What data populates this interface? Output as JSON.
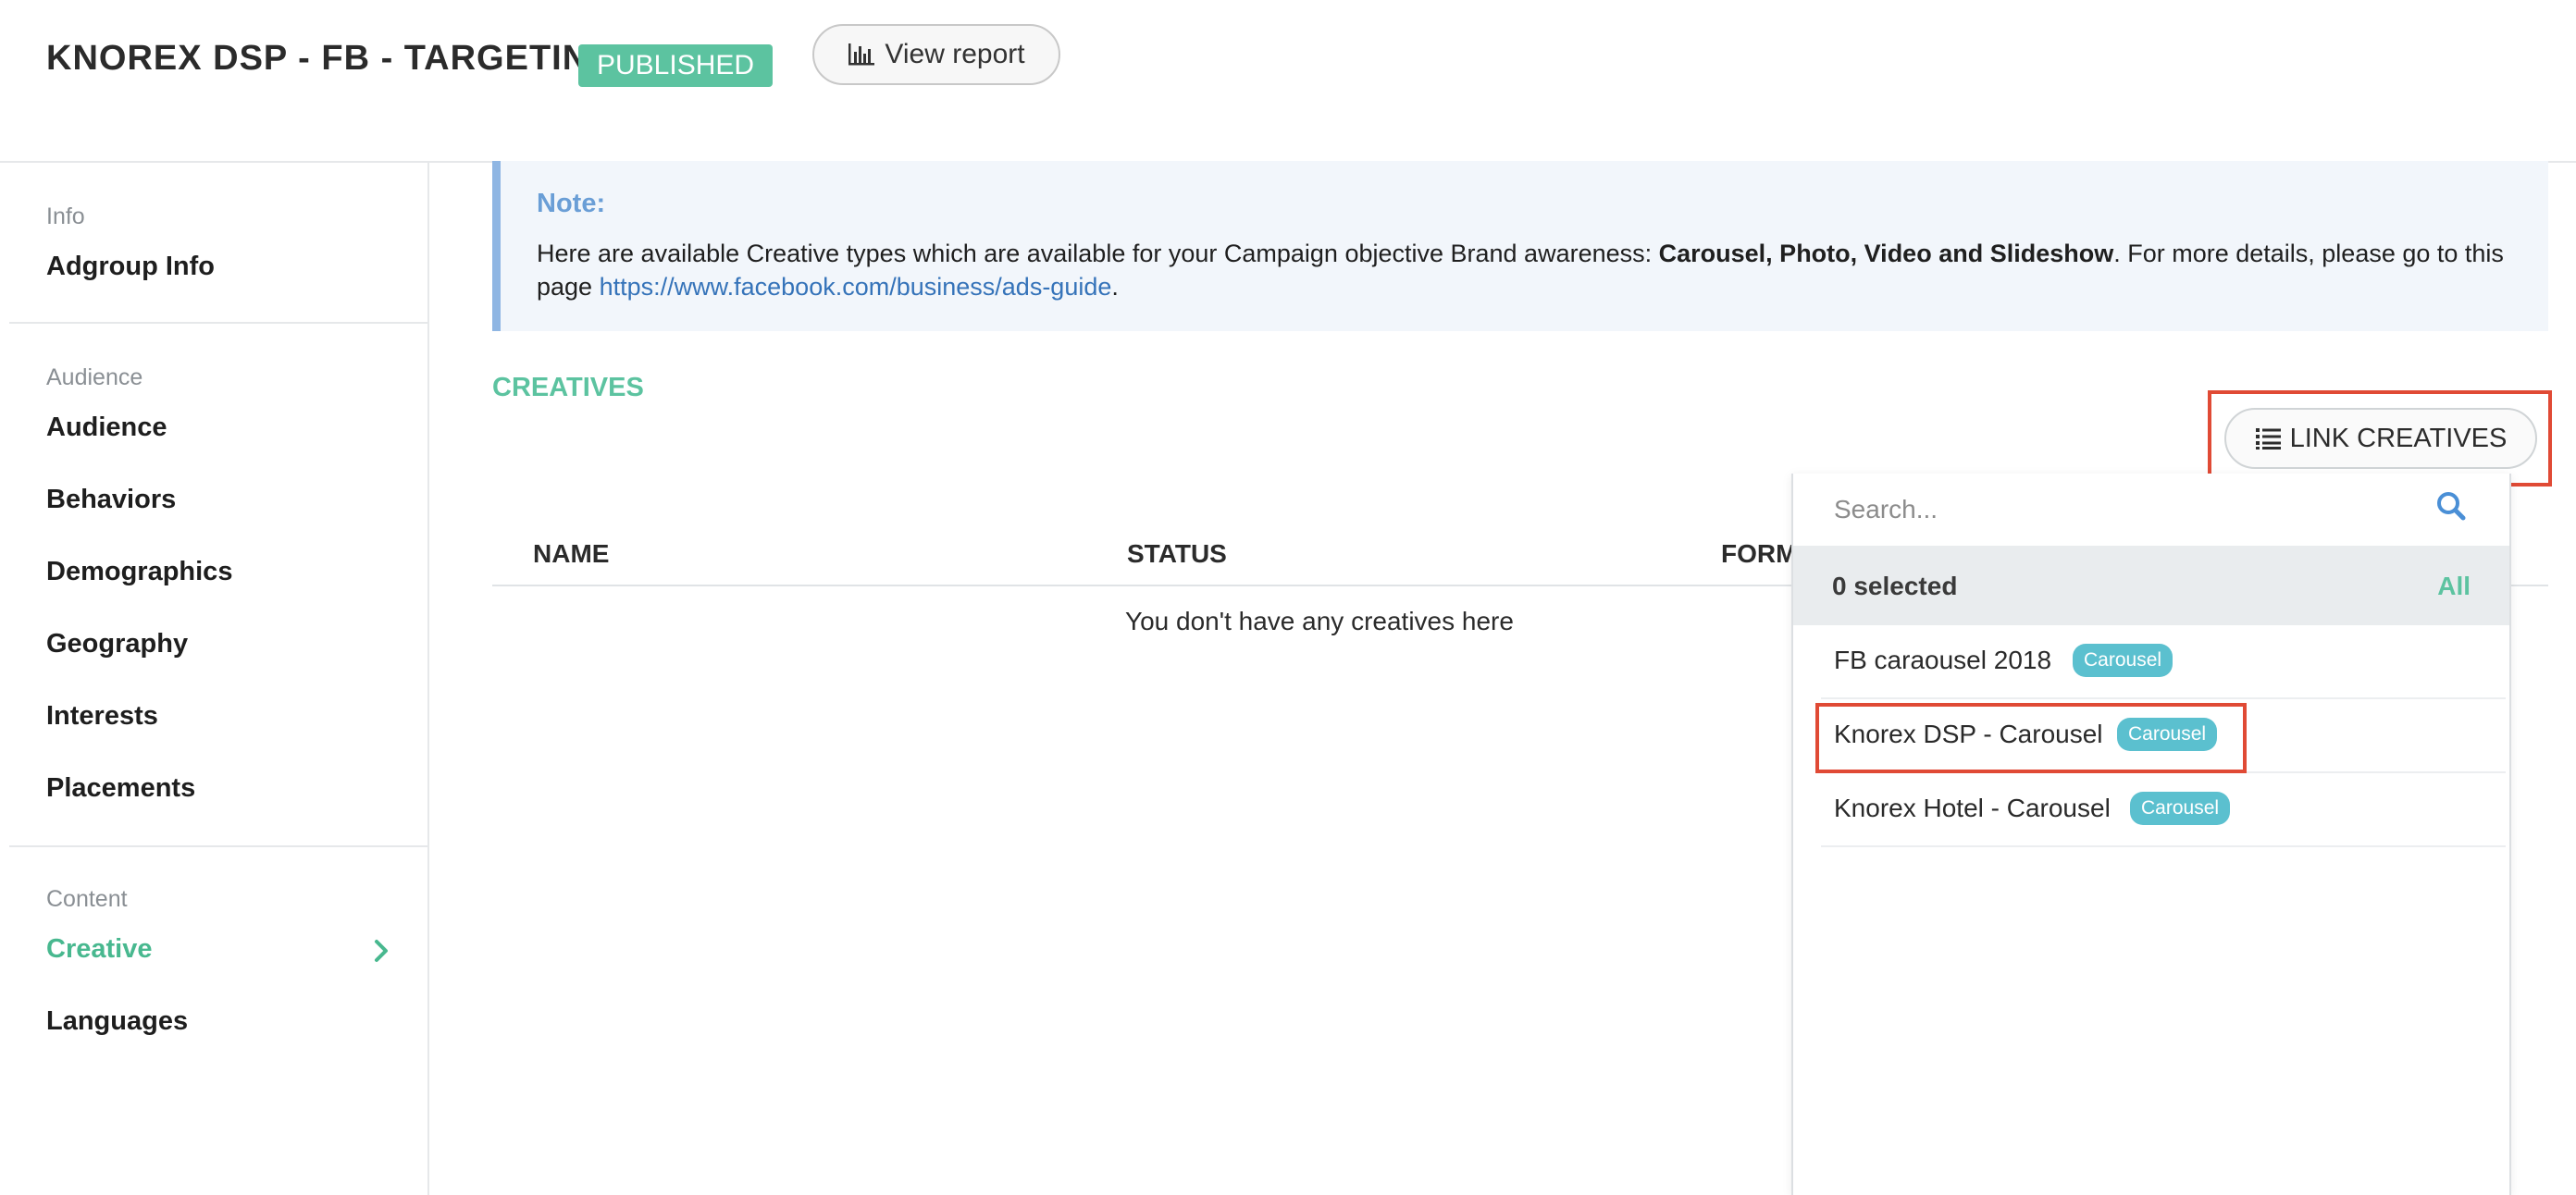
{
  "header": {
    "title": "KNOREX DSP - FB - TARGETING",
    "status_badge": "PUBLISHED",
    "view_report_label": "View report"
  },
  "sidebar": {
    "sections": [
      {
        "label": "Info",
        "items": [
          "Adgroup Info"
        ]
      },
      {
        "label": "Audience",
        "items": [
          "Audience",
          "Behaviors",
          "Demographics",
          "Geography",
          "Interests",
          "Placements"
        ]
      },
      {
        "label": "Content",
        "items": [
          "Creative",
          "Languages"
        ]
      }
    ],
    "active_item": "Creative"
  },
  "note": {
    "title": "Note:",
    "text_before": "Here are available Creative types which are available for your Campaign objective Brand awareness: ",
    "types_bold": "Carousel, Photo, Video and Slideshow",
    "text_after": ". For more details, please go to this page ",
    "link": "https://www.facebook.com/business/ads-guide",
    "text_end": "."
  },
  "creatives": {
    "heading": "CREATIVES",
    "link_button_label": "LINK CREATIVES",
    "columns": [
      "NAME",
      "STATUS",
      "FORM"
    ],
    "empty_message": "You don't have any creatives here"
  },
  "dropdown": {
    "search_placeholder": "Search...",
    "selected_text": "0 selected",
    "all_label": "All",
    "items": [
      {
        "name": "FB caraousel 2018",
        "tag": "Carousel"
      },
      {
        "name": "Knorex DSP - Carousel",
        "tag": "Carousel"
      },
      {
        "name": "Knorex Hotel - Carousel",
        "tag": "Carousel"
      }
    ]
  },
  "colors": {
    "accent_green": "#5cc3a0",
    "note_blue": "#6a9ed6",
    "tag_teal": "#5bc0cf",
    "highlight_red": "#e04a35",
    "link_blue": "#3573b9"
  },
  "icons": {
    "view_report": "bar-chart-icon",
    "link_creatives": "list-icon",
    "search": "search-icon",
    "active_chevron": "chevron-right-icon"
  }
}
